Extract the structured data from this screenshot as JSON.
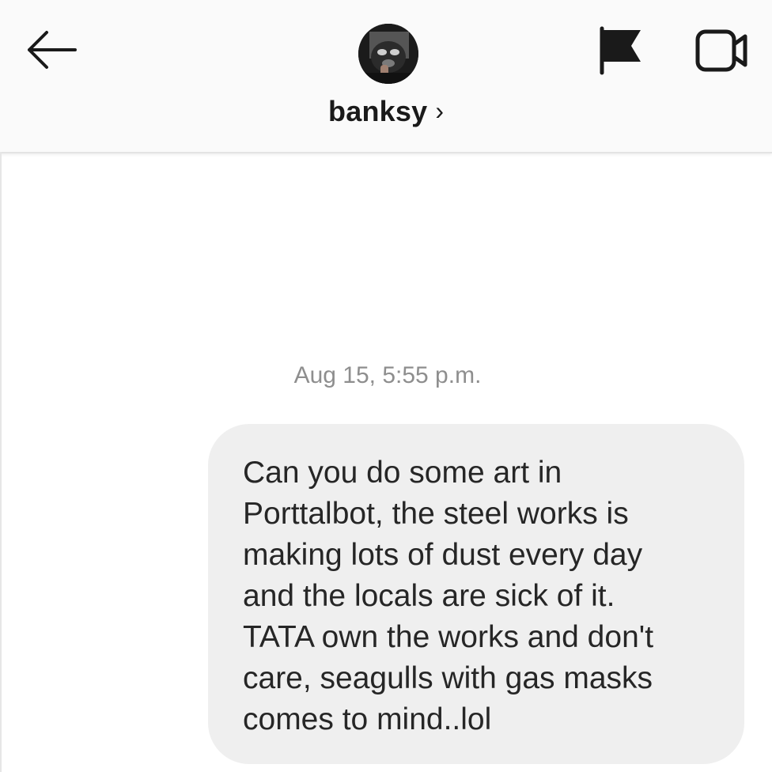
{
  "header": {
    "username": "banksy",
    "chevron": "›",
    "icons": {
      "back": "arrow-left-icon",
      "report": "flag-icon",
      "video_call": "video-camera-icon"
    }
  },
  "conversation": {
    "timestamp": "Aug 15, 5:55 p.m.",
    "messages": [
      {
        "text": "Can you do some art in\nPorttalbot, the steel works is\nmaking lots of dust every day\nand the locals are sick of it.\nTATA own the works and don't\ncare, seagulls with gas masks\ncomes to mind..lol"
      }
    ]
  },
  "colors": {
    "header_bg": "#fafafa",
    "bubble_bg": "#efefef",
    "text": "#262626",
    "timestamp": "#8e8e8e"
  }
}
